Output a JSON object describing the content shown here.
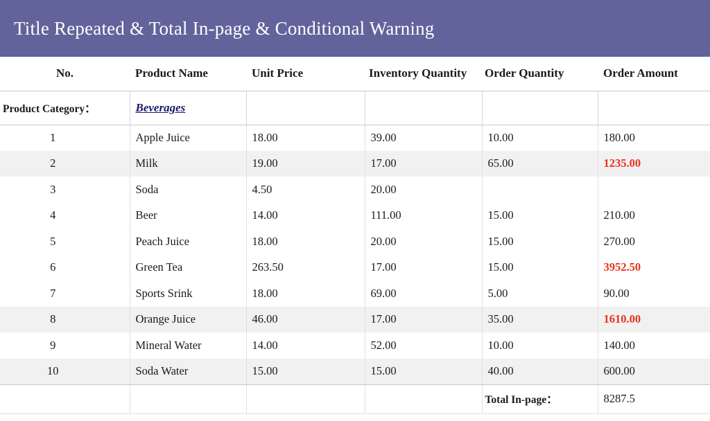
{
  "report": {
    "title": "Title Repeated & Total In-page & Conditional Warning",
    "title_band_color": "#62639b",
    "accent_link_color": "#191970",
    "warning_color": "#e8321e",
    "stripe_color": "#f1f1f1",
    "columns": [
      "No.",
      "Product Name",
      "Unit Price",
      "Inventory Quantity",
      "Order Quantity",
      "Order Amount"
    ],
    "group": {
      "label": "Product Category：",
      "value": "Beverages"
    },
    "rows": [
      {
        "no": "1",
        "name": "Apple Juice",
        "price": "18.00",
        "inventory": "39.00",
        "order_qty": "10.00",
        "amount": "180.00",
        "warn": false,
        "striped": false
      },
      {
        "no": "2",
        "name": "Milk",
        "price": "19.00",
        "inventory": "17.00",
        "order_qty": "65.00",
        "amount": "1235.00",
        "warn": true,
        "striped": true
      },
      {
        "no": "3",
        "name": "Soda",
        "price": "4.50",
        "inventory": "20.00",
        "order_qty": "",
        "amount": "",
        "warn": false,
        "striped": false
      },
      {
        "no": "4",
        "name": "Beer",
        "price": "14.00",
        "inventory": "111.00",
        "order_qty": "15.00",
        "amount": "210.00",
        "warn": false,
        "striped": false
      },
      {
        "no": "5",
        "name": "Peach Juice",
        "price": "18.00",
        "inventory": "20.00",
        "order_qty": "15.00",
        "amount": "270.00",
        "warn": false,
        "striped": false
      },
      {
        "no": "6",
        "name": "Green Tea",
        "price": "263.50",
        "inventory": "17.00",
        "order_qty": "15.00",
        "amount": "3952.50",
        "warn": true,
        "striped": false
      },
      {
        "no": "7",
        "name": "Sports Srink",
        "price": "18.00",
        "inventory": "69.00",
        "order_qty": "5.00",
        "amount": "90.00",
        "warn": false,
        "striped": false
      },
      {
        "no": "8",
        "name": "Orange Juice",
        "price": "46.00",
        "inventory": "17.00",
        "order_qty": "35.00",
        "amount": "1610.00",
        "warn": true,
        "striped": true
      },
      {
        "no": "9",
        "name": "Mineral Water",
        "price": "14.00",
        "inventory": "52.00",
        "order_qty": "10.00",
        "amount": "140.00",
        "warn": false,
        "striped": false
      },
      {
        "no": "10",
        "name": "Soda Water",
        "price": "15.00",
        "inventory": "15.00",
        "order_qty": "40.00",
        "amount": "600.00",
        "warn": false,
        "striped": true
      }
    ],
    "total": {
      "label": "Total In-page：",
      "value": "8287.5"
    }
  }
}
